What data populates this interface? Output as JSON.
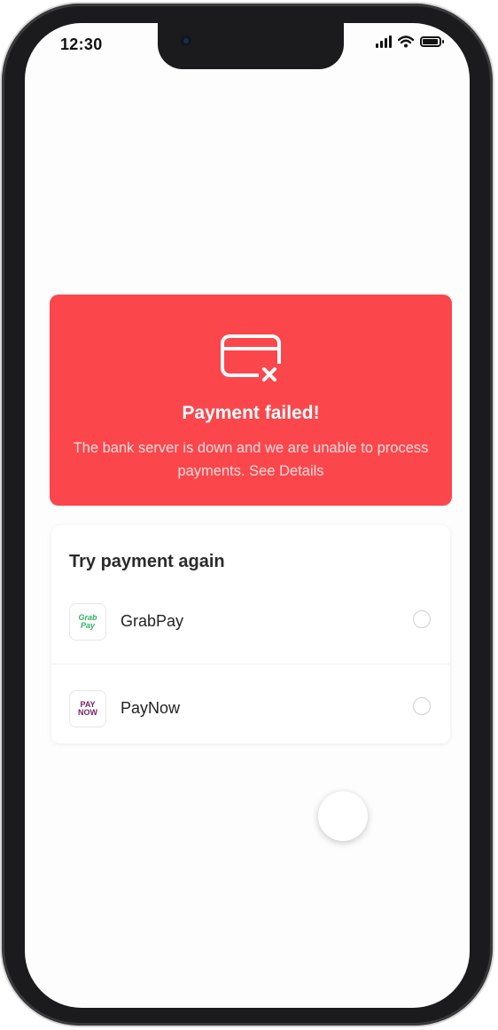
{
  "status_bar": {
    "time": "12:30"
  },
  "alert": {
    "icon": "card-failed-icon",
    "title": "Payment failed!",
    "message": "The bank server is down and we are unable to process payments. See Details",
    "background_color": "#fb464c"
  },
  "retry": {
    "title": "Try payment again",
    "options": [
      {
        "label": "GrabPay",
        "logo_text": [
          "Grab",
          "Pay"
        ],
        "logo_color": "#2fb464"
      },
      {
        "label": "PayNow",
        "logo_text": [
          "PAY",
          "NOW"
        ],
        "logo_color": "#7a1e6a"
      }
    ]
  }
}
